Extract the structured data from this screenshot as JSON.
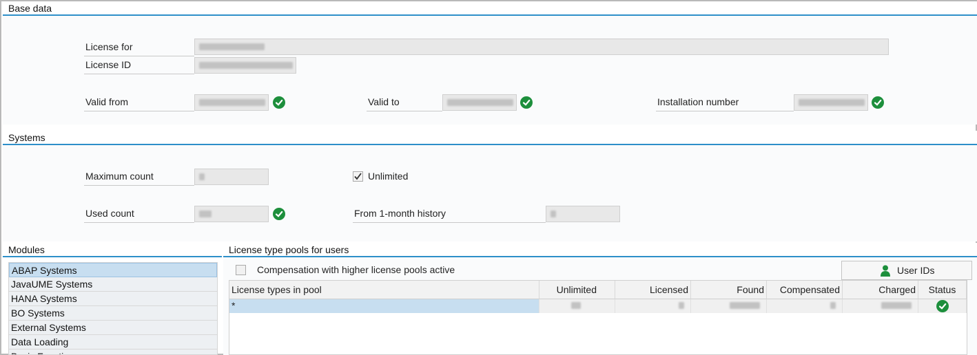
{
  "base_data": {
    "title": "Base data",
    "license_for_label": "License for",
    "license_id_label": "License ID",
    "valid_from_label": "Valid from",
    "valid_to_label": "Valid to",
    "installation_number_label": "Installation number"
  },
  "systems": {
    "title": "Systems",
    "maximum_count_label": "Maximum count",
    "unlimited_label": "Unlimited",
    "used_count_label": "Used count",
    "history_label": "From 1-month history"
  },
  "modules": {
    "title": "Modules",
    "items": [
      "ABAP Systems",
      "JavaUME Systems",
      "HANA Systems",
      "BO Systems",
      "External Systems",
      "Data Loading",
      "Basis Functions"
    ]
  },
  "pools": {
    "title": "License type pools for users",
    "compensation_label": "Compensation with higher license pools active",
    "user_ids_button": "User IDs",
    "columns": [
      "License types in pool",
      "Unlimited",
      "Licensed",
      "Found",
      "Compensated",
      "Charged",
      "Status"
    ],
    "row_first": "*"
  },
  "icons": {
    "status_ok": "check-circle-icon",
    "user": "user-icon"
  },
  "colors": {
    "accent": "#2d8fc9",
    "ok": "#1d8f3c",
    "selection": "#c7def0"
  }
}
